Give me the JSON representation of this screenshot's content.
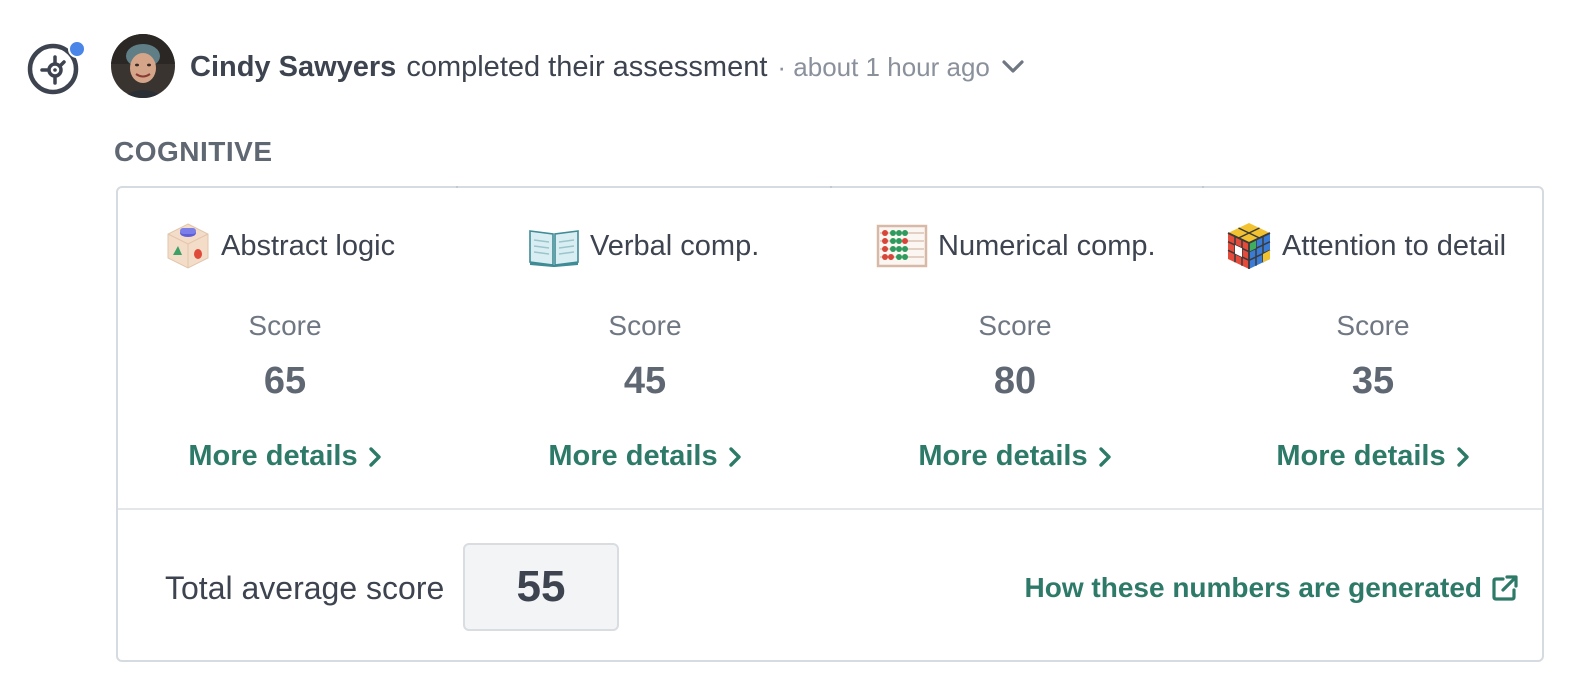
{
  "activity": {
    "user_name": "Cindy Sawyers",
    "action": "completed their assessment",
    "time": "· about 1 hour ago"
  },
  "section": {
    "title": "COGNITIVE"
  },
  "metrics": [
    {
      "name": "Abstract logic",
      "icon": "shape-cube-icon",
      "score_label": "Score",
      "score": "65",
      "link": "More details"
    },
    {
      "name": "Verbal comp.",
      "icon": "open-book-icon",
      "score_label": "Score",
      "score": "45",
      "link": "More details"
    },
    {
      "name": "Numerical comp.",
      "icon": "abacus-icon",
      "score_label": "Score",
      "score": "80",
      "link": "More details"
    },
    {
      "name": "Attention to detail",
      "icon": "rubiks-cube-icon",
      "score_label": "Score",
      "score": "35",
      "link": "More details"
    }
  ],
  "summary": {
    "label": "Total average score",
    "value": "55",
    "link": "How these numbers are generated"
  },
  "colors": {
    "accent": "#2e7a68",
    "notify": "#4a86e8",
    "text": "#3d4450",
    "muted": "#8a919c"
  }
}
